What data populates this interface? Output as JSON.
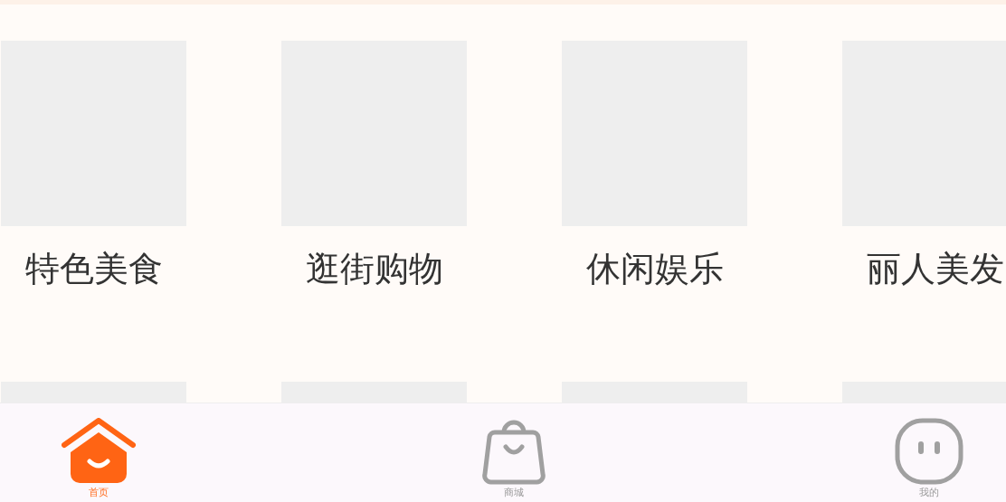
{
  "categories": [
    {
      "label": "特色美食"
    },
    {
      "label": "逛街购物"
    },
    {
      "label": "休闲娱乐"
    },
    {
      "label": "丽人美发"
    }
  ],
  "next_row": [
    {
      "kind": "tile"
    },
    {
      "kind": "tile"
    },
    {
      "kind": "tile"
    },
    {
      "kind": "tile"
    }
  ],
  "tab_bar": [
    {
      "kind": "home",
      "label": "首页",
      "selected": true
    },
    {
      "kind": "shop",
      "label": "商城",
      "selected": false
    },
    {
      "kind": "profile",
      "label": "我的",
      "selected": false
    }
  ]
}
